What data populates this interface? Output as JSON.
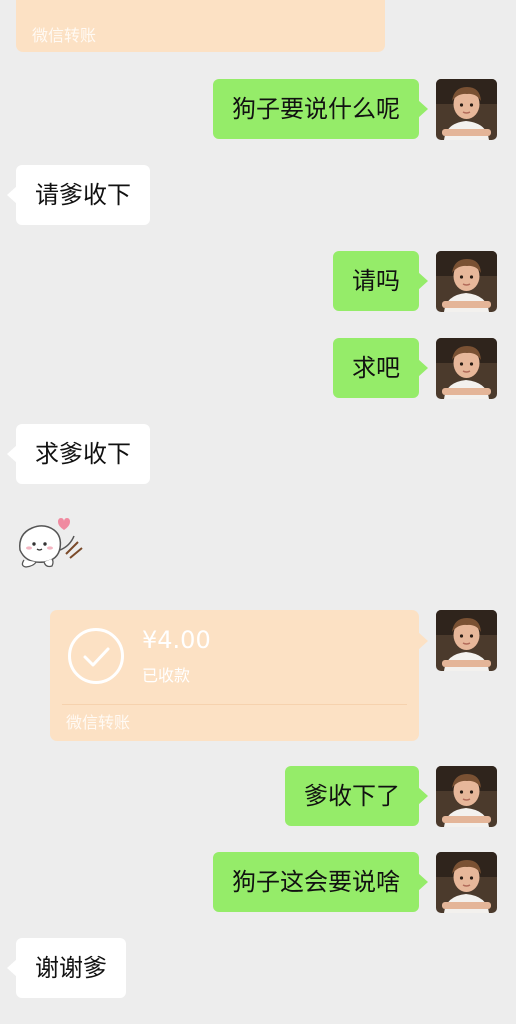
{
  "messages": [
    {
      "side": "them",
      "type": "transfer",
      "footer": "微信转账"
    },
    {
      "side": "me",
      "type": "text",
      "text": "狗子要说什么呢"
    },
    {
      "side": "them",
      "type": "text",
      "text": "请爹收下"
    },
    {
      "side": "me",
      "type": "text",
      "text": "请吗"
    },
    {
      "side": "me",
      "type": "text",
      "text": "求吧"
    },
    {
      "side": "them",
      "type": "text",
      "text": "求爹收下"
    },
    {
      "side": "them",
      "type": "sticker",
      "icon": "puppy-with-heart-sticker"
    },
    {
      "side": "me",
      "type": "transfer",
      "amount": "¥4.00",
      "status": "已收款",
      "footer": "微信转账"
    },
    {
      "side": "me",
      "type": "text",
      "text": "爹收下了"
    },
    {
      "side": "me",
      "type": "text",
      "text": "狗子这会要说啥"
    },
    {
      "side": "them",
      "type": "text",
      "text": "谢谢爹"
    }
  ],
  "colors": {
    "background": "#ededed",
    "my_bubble": "#95ec69",
    "their_bubble": "#ffffff",
    "transfer_card": "#fce1c4"
  }
}
